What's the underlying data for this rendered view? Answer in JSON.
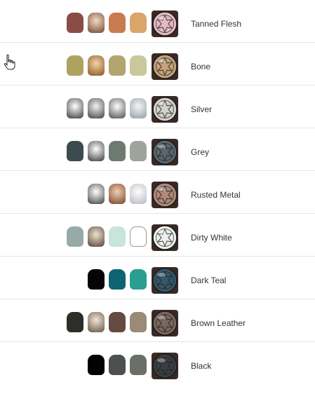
{
  "rows": [
    {
      "label": "Tanned Flesh",
      "swatch": "#e7b9c4",
      "pots": [
        "#8a4d45",
        [
          "#f0d9c8",
          "#7a4e34"
        ],
        "#c97a4f",
        "#d9a56b"
      ]
    },
    {
      "label": "Bone",
      "swatch": "#c7a27a",
      "pots": [
        "#aea25f",
        [
          "#f3d3a5",
          "#8b5a2b"
        ],
        "#b2a56e",
        "#c9c89a"
      ]
    },
    {
      "label": "Silver",
      "swatch": "#d5d2cc",
      "pots": [
        [
          "#ffffff",
          "#444444"
        ],
        [
          "#f2f2f2",
          "#4a4a4a"
        ],
        [
          "#ffffff",
          "#555555"
        ],
        [
          "#f4f4f6",
          "#9aa0a8"
        ]
      ]
    },
    {
      "label": "Grey",
      "swatch": "#5b666f",
      "pots": [
        "#3d4a4e",
        [
          "#ffffff",
          "#444444"
        ],
        "#6e7a70",
        "#9ea39b"
      ]
    },
    {
      "label": "Rusted Metal",
      "swatch": "#b28a7a",
      "pots": [
        [
          "#ffffff",
          "#4a4a4a"
        ],
        [
          "#f0d0b2",
          "#7e4a2d"
        ],
        [
          "#ffffff",
          "#b9bcc2"
        ]
      ]
    },
    {
      "label": "Dirty White",
      "swatch": "#eef0f0",
      "pots": [
        "#98aaa8",
        [
          "#f0e0d0",
          "#5a4a3a"
        ],
        "#c8e4dc",
        "#ffffff"
      ]
    },
    {
      "label": "Dark Teal",
      "swatch": "#35576a",
      "pots": [
        "#050505",
        "#0d6572",
        "#2a9e90"
      ]
    },
    {
      "label": "Brown Leather",
      "swatch": "#7a675e",
      "pots": [
        "#2e2e28",
        [
          "#f2e6d8",
          "#6a5a4a"
        ],
        "#654a42",
        "#9a8a76"
      ]
    },
    {
      "label": "Black",
      "swatch": "#3a3d42",
      "pots": [
        "#030303",
        "#4c5050",
        "#6a7068"
      ]
    }
  ],
  "cursor": "pointer-hand-icon"
}
